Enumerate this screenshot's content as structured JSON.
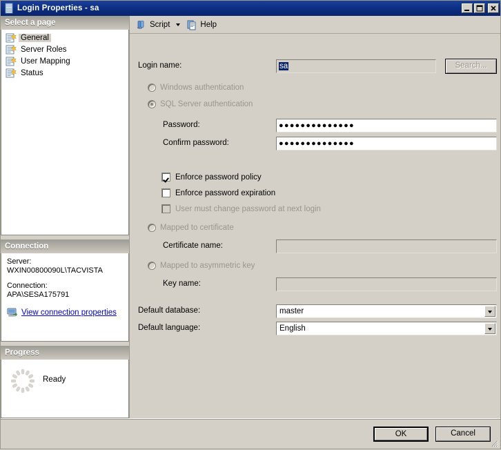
{
  "window": {
    "title": "Login Properties - sa",
    "icon": "login-properties-icon",
    "minimize": "_",
    "maximize": "□",
    "close": "×"
  },
  "sidebar": {
    "header": "Select a page",
    "items": [
      {
        "label": "General",
        "icon": "page-icon",
        "selected": true
      },
      {
        "label": "Server Roles",
        "icon": "page-icon",
        "selected": false
      },
      {
        "label": "User Mapping",
        "icon": "page-icon",
        "selected": false
      },
      {
        "label": "Status",
        "icon": "page-icon",
        "selected": false
      }
    ],
    "connection": {
      "header": "Connection",
      "server_label": "Server:",
      "server_value": "WXIN00800090L\\TACVISTA",
      "connection_label": "Connection:",
      "connection_value": "APA\\SESA175791",
      "link_text": "View connection properties",
      "link_icon": "server-connection-icon",
      "link_color": "#0000c8"
    },
    "progress": {
      "header": "Progress",
      "status": "Ready",
      "spinner_icon": "progress-spinner-icon"
    }
  },
  "toolbar": {
    "script_label": "Script",
    "script_icon": "script-scroll-icon",
    "dropdown_icon": "chevron-down-icon",
    "help_label": "Help",
    "help_icon": "help-page-icon"
  },
  "form": {
    "login_name_label": "Login name:",
    "login_name_value": "sa",
    "search_button": "Search...",
    "windows_auth_label": "Windows authentication",
    "windows_auth_checked": false,
    "sql_auth_label": "SQL Server authentication",
    "sql_auth_checked": true,
    "password_label": "Password:",
    "password_value": "●●●●●●●●●●●●●●",
    "confirm_password_label": "Confirm password:",
    "confirm_password_value": "●●●●●●●●●●●●●●",
    "enforce_policy_label": "Enforce password policy",
    "enforce_policy_checked": true,
    "enforce_expiration_label": "Enforce password expiration",
    "enforce_expiration_checked": false,
    "must_change_label": "User must change password at next login",
    "must_change_checked": false,
    "mapped_certificate_label": "Mapped to certificate",
    "certificate_name_label": "Certificate name:",
    "certificate_name_value": "",
    "mapped_asymmetric_label": "Mapped to asymmetric key",
    "key_name_label": "Key name:",
    "key_name_value": "",
    "default_database_label": "Default database:",
    "default_database_value": "master",
    "default_language_label": "Default language:",
    "default_language_value": "English"
  },
  "footer": {
    "ok_label": "OK",
    "cancel_label": "Cancel"
  }
}
